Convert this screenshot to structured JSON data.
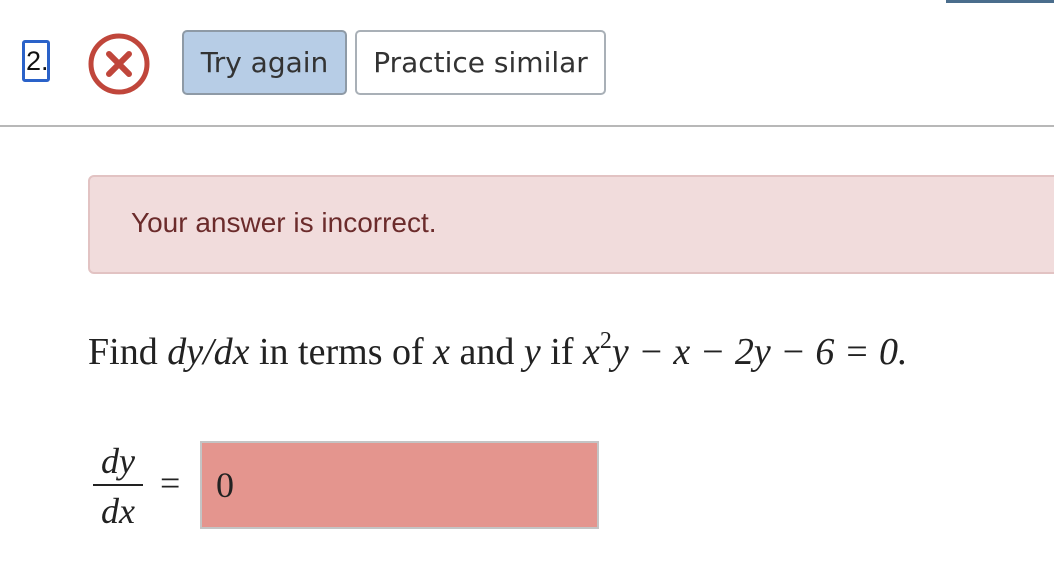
{
  "header": {
    "question_number": "2.",
    "status_icon": "x-circle-icon",
    "try_again_label": "Try again",
    "practice_similar_label": "Practice similar"
  },
  "feedback": {
    "message": "Your answer is incorrect."
  },
  "problem": {
    "prefix": "Find ",
    "derivative": "dy/dx",
    "mid1": " in terms of ",
    "var_x": "x",
    "mid2": " and ",
    "var_y": "y",
    "mid3": " if ",
    "eq_x": "x",
    "eq_exp": "2",
    "eq_rest": "y − x − 2y − 6 = 0."
  },
  "answer": {
    "lhs_numerator": "dy",
    "lhs_denominator": "dx",
    "equals": "=",
    "value": "0"
  },
  "colors": {
    "incorrect_icon": "#c0463b",
    "try_again_bg": "#b7cde6",
    "alert_bg": "#f1dcdc",
    "alert_text": "#6b2b2b",
    "answer_bg_incorrect": "#e4958e",
    "question_number_border": "#2a62c9"
  }
}
